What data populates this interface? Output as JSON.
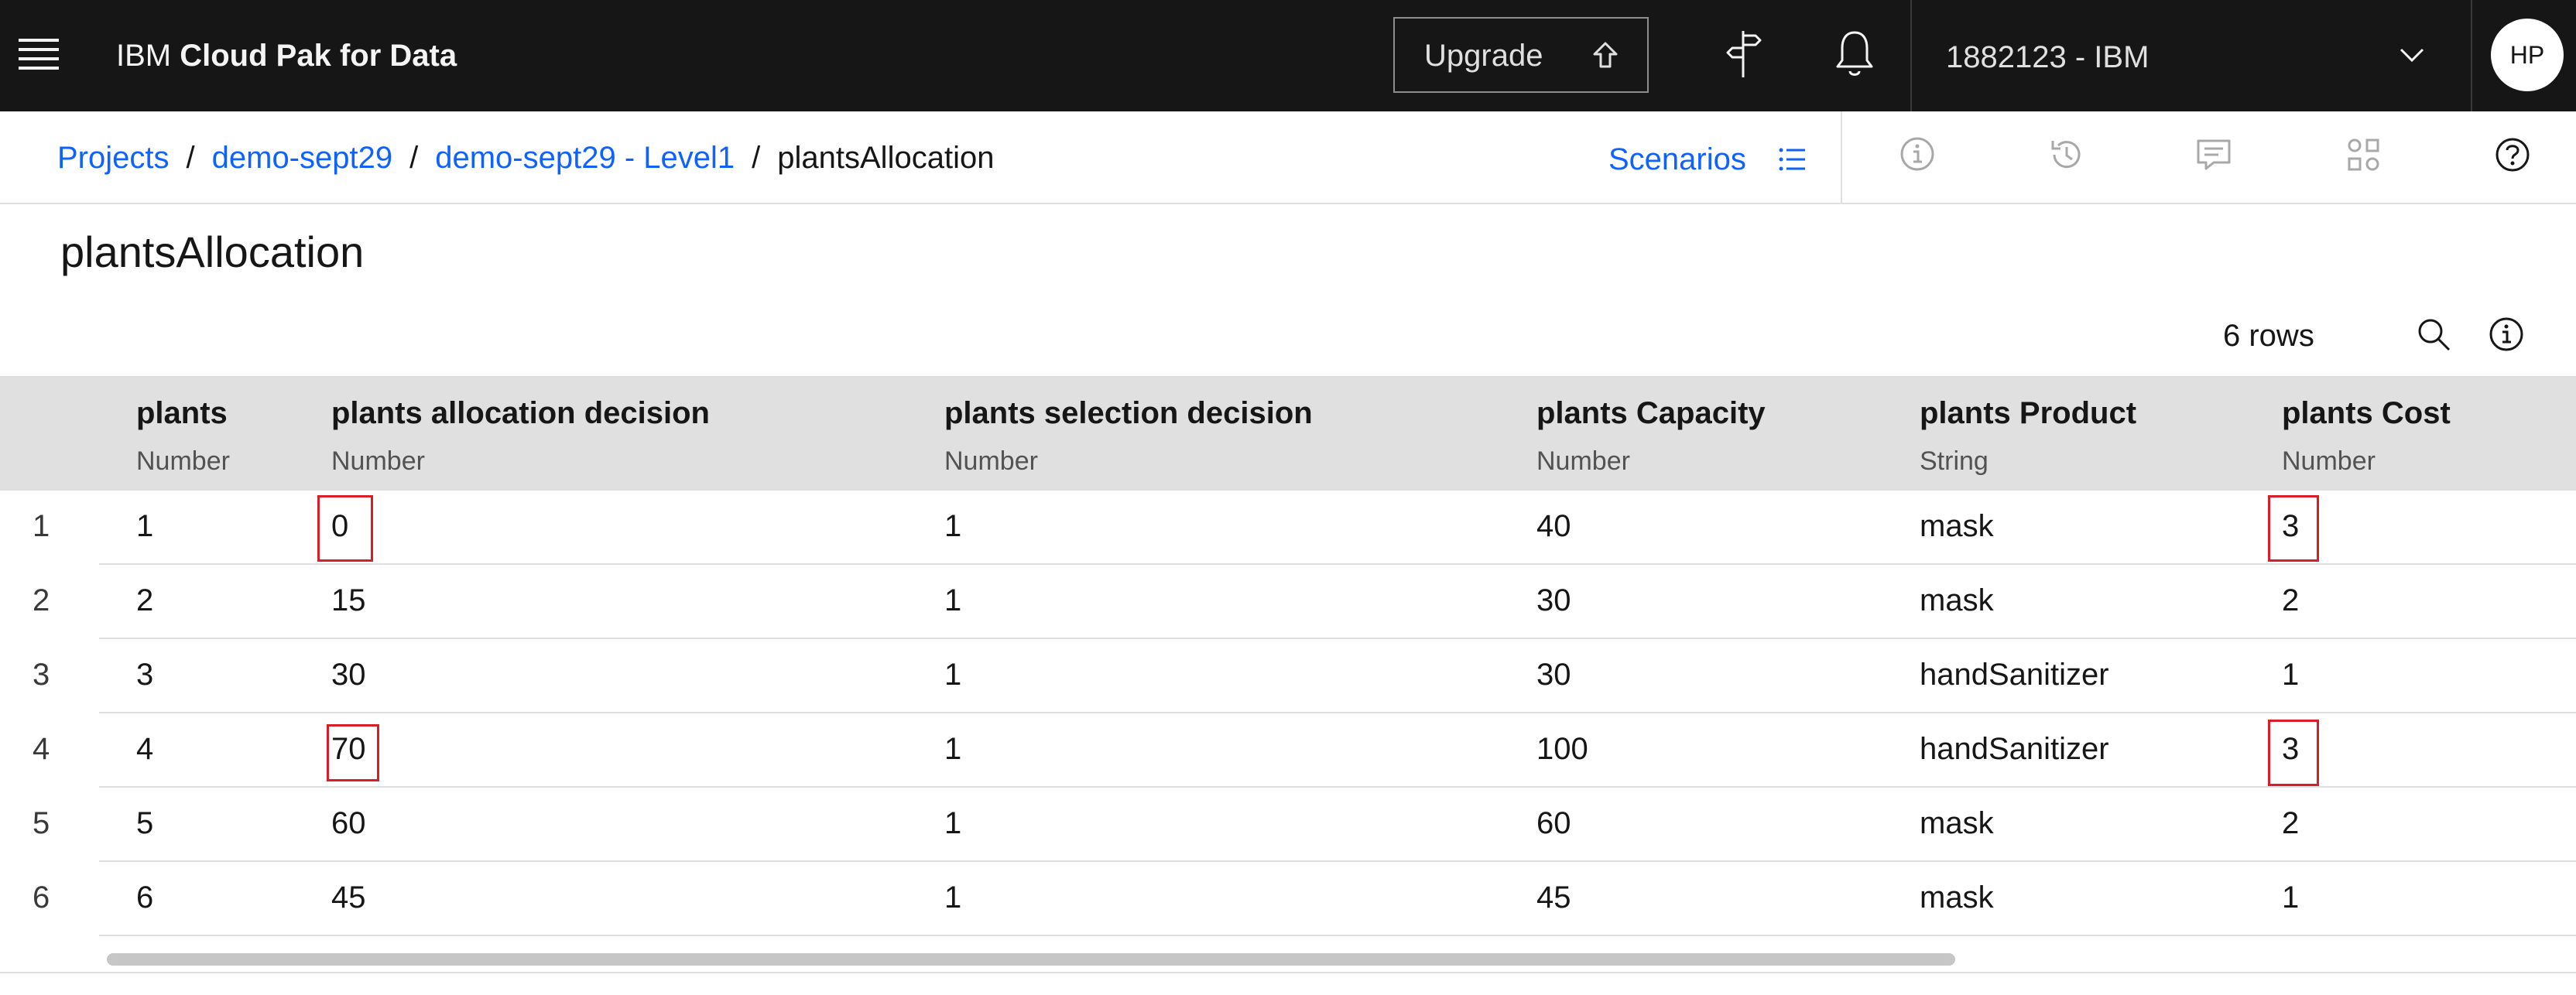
{
  "header": {
    "brand_prefix": "IBM",
    "brand_product": "Cloud Pak for Data",
    "upgrade_label": "Upgrade",
    "account_label": "1882123 - IBM",
    "avatar_initials": "HP"
  },
  "breadcrumb": {
    "items": [
      "Projects",
      "demo-sept29",
      "demo-sept29 - Level1"
    ],
    "separator": "/",
    "current": "plantsAllocation"
  },
  "toolbar": {
    "scenarios_label": "Scenarios"
  },
  "page": {
    "title": "plantsAllocation",
    "row_count": "6 rows"
  },
  "table": {
    "columns": [
      {
        "name": "plants",
        "type": "Number"
      },
      {
        "name": "plants allocation decision",
        "type": "Number"
      },
      {
        "name": "plants selection decision",
        "type": "Number"
      },
      {
        "name": "plants Capacity",
        "type": "Number"
      },
      {
        "name": "plants Product",
        "type": "String"
      },
      {
        "name": "plants Cost",
        "type": "Number"
      }
    ],
    "rows": [
      {
        "index": "1",
        "cells": [
          "1",
          "0",
          "1",
          "40",
          "mask",
          "3"
        ]
      },
      {
        "index": "2",
        "cells": [
          "2",
          "15",
          "1",
          "30",
          "mask",
          "2"
        ]
      },
      {
        "index": "3",
        "cells": [
          "3",
          "30",
          "1",
          "30",
          "handSanitizer",
          "1"
        ]
      },
      {
        "index": "4",
        "cells": [
          "4",
          "70",
          "1",
          "100",
          "handSanitizer",
          "3"
        ]
      },
      {
        "index": "5",
        "cells": [
          "5",
          "60",
          "1",
          "60",
          "mask",
          "2"
        ]
      },
      {
        "index": "6",
        "cells": [
          "6",
          "45",
          "1",
          "45",
          "mask",
          "1"
        ]
      }
    ]
  },
  "icons": {
    "header": [
      "menu-icon",
      "arrow-up-icon",
      "signpost-icon",
      "notification-bell-icon",
      "chevron-down-icon"
    ],
    "toolbar": [
      "list-icon",
      "info-icon",
      "history-icon",
      "comment-icon",
      "apps-icon",
      "help-icon"
    ],
    "table_tools": [
      "search-icon",
      "info-icon"
    ]
  },
  "colors": {
    "header_bg": "#161616",
    "link": "#0f62fe",
    "highlight_border": "#da1e28",
    "table_header_bg": "#e0e0e0"
  },
  "highlighted_cells": [
    {
      "row": "1",
      "column": "plants allocation decision"
    },
    {
      "row": "1",
      "column": "plants Cost"
    },
    {
      "row": "4",
      "column": "plants allocation decision"
    },
    {
      "row": "4",
      "column": "plants Cost"
    }
  ]
}
